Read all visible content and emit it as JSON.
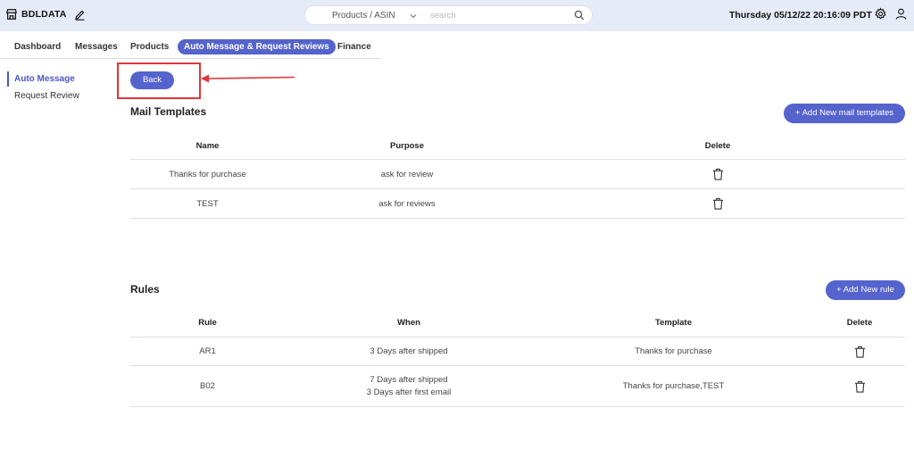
{
  "header": {
    "brand": "BDLDATA",
    "search_scope": "Products / ASIN",
    "search_placeholder": "search",
    "datetime": "Thursday 05/12/22 20:16:09 PDT"
  },
  "tabs": [
    {
      "label": "Dashboard",
      "active": false
    },
    {
      "label": "Messages",
      "active": false
    },
    {
      "label": "Products",
      "active": false
    },
    {
      "label": "Auto Message & Request Reviews",
      "active": true
    },
    {
      "label": "Finance",
      "active": false
    }
  ],
  "submenu": [
    {
      "label": "Auto Message",
      "active": true
    },
    {
      "label": "Request Review",
      "active": false
    }
  ],
  "back_label": "Back",
  "mail_templates": {
    "title": "Mail Templates",
    "add_button": "+ Add New mail templates",
    "columns": [
      "Name",
      "Purpose",
      "Delete"
    ],
    "rows": [
      {
        "name": "Thanks for purchase",
        "purpose": "ask for review"
      },
      {
        "name": "TEST",
        "purpose": "ask for reviews"
      }
    ]
  },
  "rules": {
    "title": "Rules",
    "add_button": "+ Add New rule",
    "columns": [
      "Rule",
      "When",
      "Template",
      "Delete"
    ],
    "rows": [
      {
        "rule": "AR1",
        "when_1": "3 Days after shipped",
        "when_2": "",
        "template": "Thanks for purchase"
      },
      {
        "rule": "B02",
        "when_1": "7 Days after shipped",
        "when_2": "3 Days after first email",
        "template": "Thanks for purchase,TEST"
      }
    ]
  },
  "colors": {
    "accent": "#5563cc",
    "topbar": "#e6ebf8",
    "annotation": "#e0343a"
  },
  "icons": [
    "store-icon",
    "edit-icon",
    "chevron-down-icon",
    "search-icon",
    "gear-icon",
    "user-icon",
    "trash-icon"
  ]
}
